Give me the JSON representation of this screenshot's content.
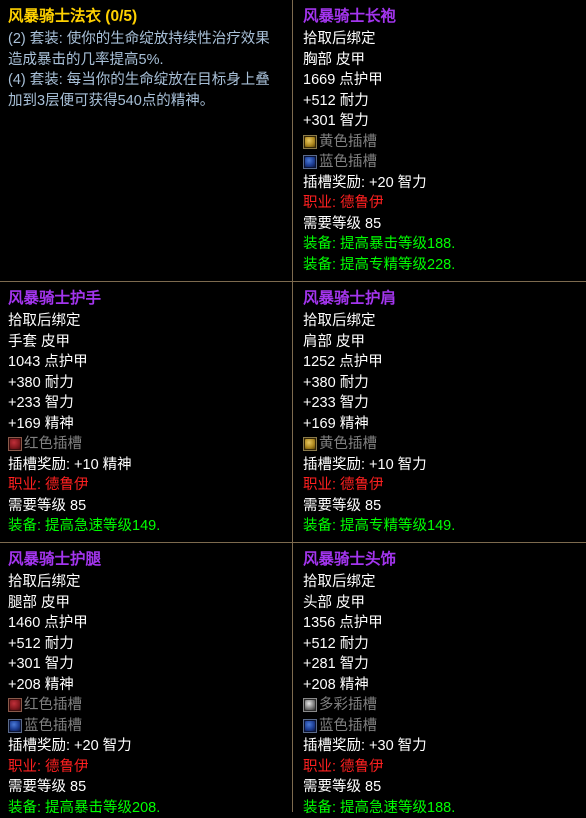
{
  "theme": {
    "background": "#000000",
    "divider_color": "#7d6a4e",
    "epic_color": "#a335ee",
    "set_title_color": "#ffd100",
    "set_bonus_color": "#a8c0d8",
    "green_color": "#00ff00",
    "red_color": "#ff2020",
    "socket_label_color": "#808080"
  },
  "set_tooltip": {
    "name": "风暴骑士法衣 (0/5)",
    "bonuses": [
      "(2) 套装: 使你的生命绽放持续性治疗效果造成暴击的几率提高5%.",
      "(4) 套装: 每当你的生命绽放在目标身上叠加到3层便可获得540点的精神。"
    ]
  },
  "items": [
    {
      "name": "风暴骑士长袍",
      "bind": "拾取后绑定",
      "slot": "胸部 皮甲",
      "armor": "1669 点护甲",
      "stats": [
        "+512 耐力",
        "+301 智力"
      ],
      "sockets": [
        {
          "color": "yellow",
          "label": "黄色插槽"
        },
        {
          "color": "blue",
          "label": "蓝色插槽"
        }
      ],
      "socket_bonus": "插槽奖励: +20 智力",
      "class_req": "职业: 德鲁伊",
      "level_req": "需要等级 85",
      "equip_effects": [
        "装备: 提高暴击等级188.",
        "装备: 提高专精等级228."
      ]
    },
    {
      "name": "风暴骑士护手",
      "bind": "拾取后绑定",
      "slot": "手套 皮甲",
      "armor": "1043 点护甲",
      "stats": [
        "+380 耐力",
        "+233 智力",
        "+169 精神"
      ],
      "sockets": [
        {
          "color": "red",
          "label": "红色插槽"
        }
      ],
      "socket_bonus": "插槽奖励: +10 精神",
      "class_req": "职业: 德鲁伊",
      "level_req": "需要等级 85",
      "equip_effects": [
        "装备: 提高急速等级149."
      ]
    },
    {
      "name": "风暴骑士护肩",
      "bind": "拾取后绑定",
      "slot": "肩部 皮甲",
      "armor": "1252 点护甲",
      "stats": [
        "+380 耐力",
        "+233 智力",
        "+169 精神"
      ],
      "sockets": [
        {
          "color": "yellow",
          "label": "黄色插槽"
        }
      ],
      "socket_bonus": "插槽奖励: +10 智力",
      "class_req": "职业: 德鲁伊",
      "level_req": "需要等级 85",
      "equip_effects": [
        "装备: 提高专精等级149."
      ]
    },
    {
      "name": "风暴骑士护腿",
      "bind": "拾取后绑定",
      "slot": "腿部 皮甲",
      "armor": "1460 点护甲",
      "stats": [
        "+512 耐力",
        "+301 智力",
        "+208 精神"
      ],
      "sockets": [
        {
          "color": "red",
          "label": "红色插槽"
        },
        {
          "color": "blue",
          "label": "蓝色插槽"
        }
      ],
      "socket_bonus": "插槽奖励: +20 智力",
      "class_req": "职业: 德鲁伊",
      "level_req": "需要等级 85",
      "equip_effects": [
        "装备: 提高暴击等级208."
      ]
    },
    {
      "name": "风暴骑士头饰",
      "bind": "拾取后绑定",
      "slot": "头部 皮甲",
      "armor": "1356 点护甲",
      "stats": [
        "+512 耐力",
        "+281 智力",
        "+208 精神"
      ],
      "sockets": [
        {
          "color": "prism",
          "label": "多彩插槽"
        },
        {
          "color": "blue",
          "label": "蓝色插槽"
        }
      ],
      "socket_bonus": "插槽奖励: +30 智力",
      "class_req": "职业: 德鲁伊",
      "level_req": "需要等级 85",
      "equip_effects": [
        "装备: 提高急速等级188."
      ]
    }
  ]
}
